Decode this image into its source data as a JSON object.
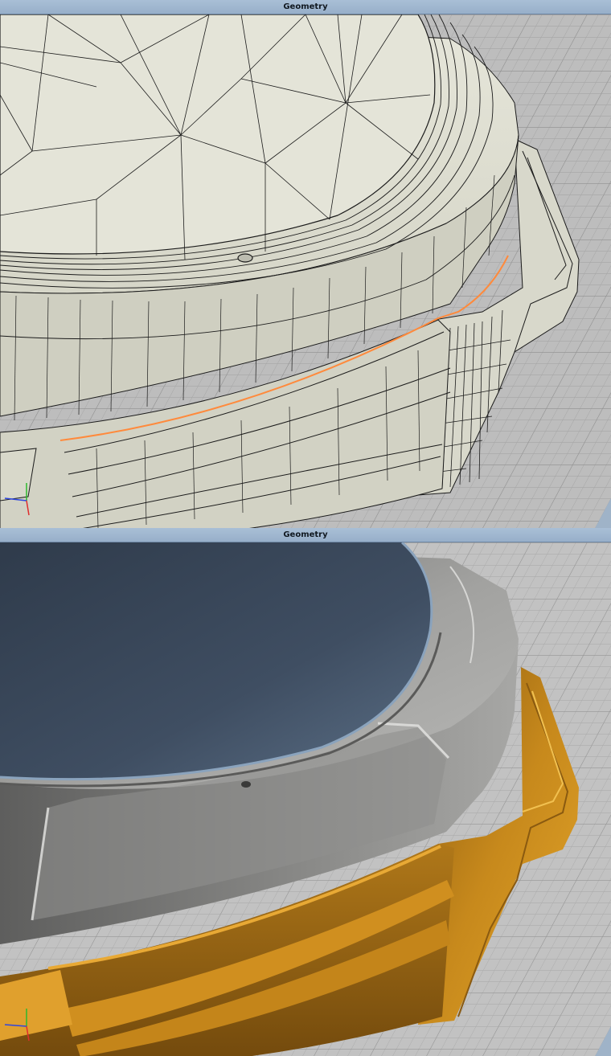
{
  "viewports": [
    {
      "title": "Geometry",
      "mode": "wireframe"
    },
    {
      "title": "Geometry",
      "mode": "shaded"
    }
  ],
  "colors": {
    "title_bar": "#9fb3c8",
    "grid_floor": "#b9b9b9",
    "mesh_surface": "#dcdccf",
    "wire": "#1b1b1b",
    "selected_edge": "#ff8a3c",
    "shaded_grey": "#8c8c8a",
    "shaded_top": "#3f4e62",
    "shaded_band": "#d1941f"
  },
  "axis_gizmo": {
    "icons": [
      "axis-x-icon",
      "axis-y-icon",
      "axis-z-icon"
    ]
  }
}
